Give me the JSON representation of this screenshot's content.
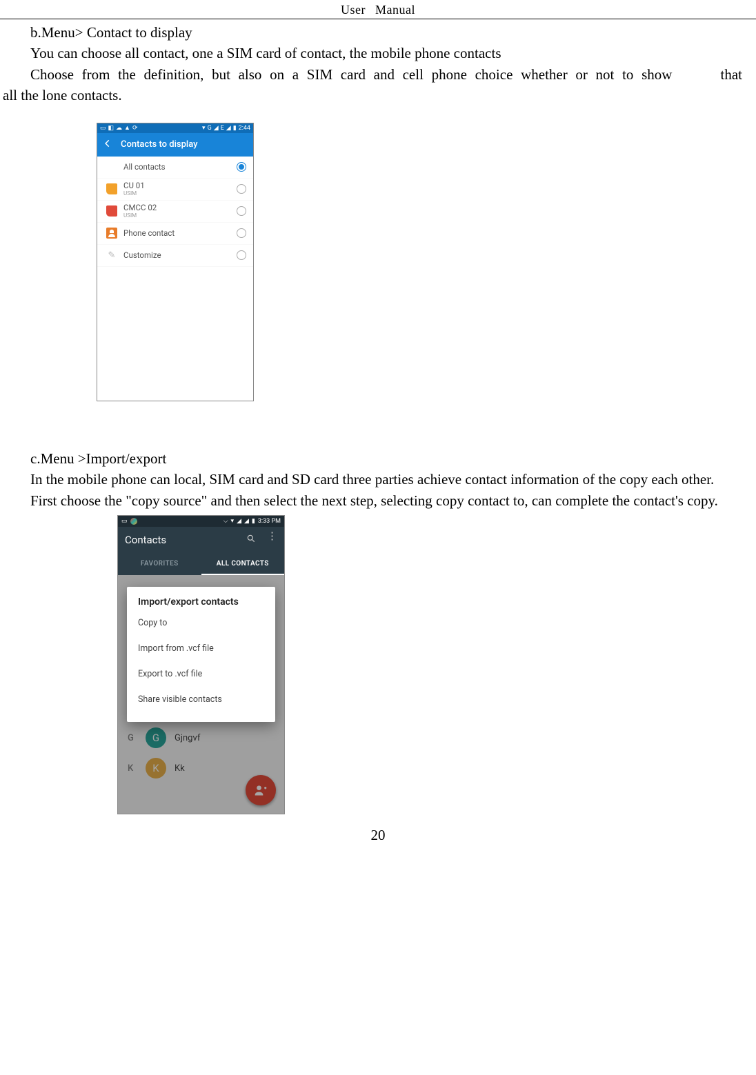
{
  "header": {
    "left": "User",
    "right": "Manual"
  },
  "page_number": "20",
  "body": {
    "p1": "b.Menu> Contact to display",
    "p2": "You can choose all contact, one a SIM card of contact, the mobile phone contacts",
    "p3_a": "Choose from the definition, but also on a SIM card and cell phone choice whether or not to show",
    "p3_b": "that",
    "p3_c": "all the lone contacts.",
    "p4": "c.Menu >Import/export",
    "p5": "In the mobile phone can local, SIM card and SD card three parties achieve contact information of the copy each other.",
    "p6": "First choose the \"copy source\" and then select the next step, selecting copy contact to, can complete the contact's copy."
  },
  "screenshot1": {
    "status": {
      "time": "2:44",
      "left_icons": [
        "message",
        "contacts",
        "cloud",
        "warning",
        "update"
      ],
      "right_icons": [
        "wifi",
        "G",
        "signal",
        "E",
        "signal2",
        "battery"
      ]
    },
    "appbar_title": "Contacts to display",
    "rows": [
      {
        "label": "All contacts",
        "sub": "",
        "icon": "none",
        "selected": true
      },
      {
        "label": "CU 01",
        "sub": "USIM",
        "icon": "sim-orange",
        "selected": false
      },
      {
        "label": "CMCC 02",
        "sub": "USIM",
        "icon": "sim-red",
        "selected": false
      },
      {
        "label": "Phone contact",
        "sub": "",
        "icon": "person",
        "selected": false
      },
      {
        "label": "Customize",
        "sub": "",
        "icon": "customize",
        "selected": false
      }
    ]
  },
  "screenshot2": {
    "status": {
      "time": "3:33 PM",
      "left_icons": [
        "message",
        "app"
      ],
      "right_icons": [
        "bluetooth",
        "wifi",
        "signal",
        "signal2",
        "battery"
      ]
    },
    "appbar_title": "Contacts",
    "tabs": {
      "fav": "FAVORITES",
      "all": "ALL CONTACTS"
    },
    "dialog": {
      "title": "Import/export contacts",
      "options": [
        "Copy to",
        "Import from .vcf file",
        "Export to .vcf file",
        "Share visible contacts"
      ]
    },
    "bg_contacts": [
      {
        "index": "G",
        "initial": "G",
        "name": "Gjngvf",
        "color": "teal"
      },
      {
        "index": "K",
        "initial": "K",
        "name": "Kk",
        "color": "amber"
      }
    ]
  }
}
